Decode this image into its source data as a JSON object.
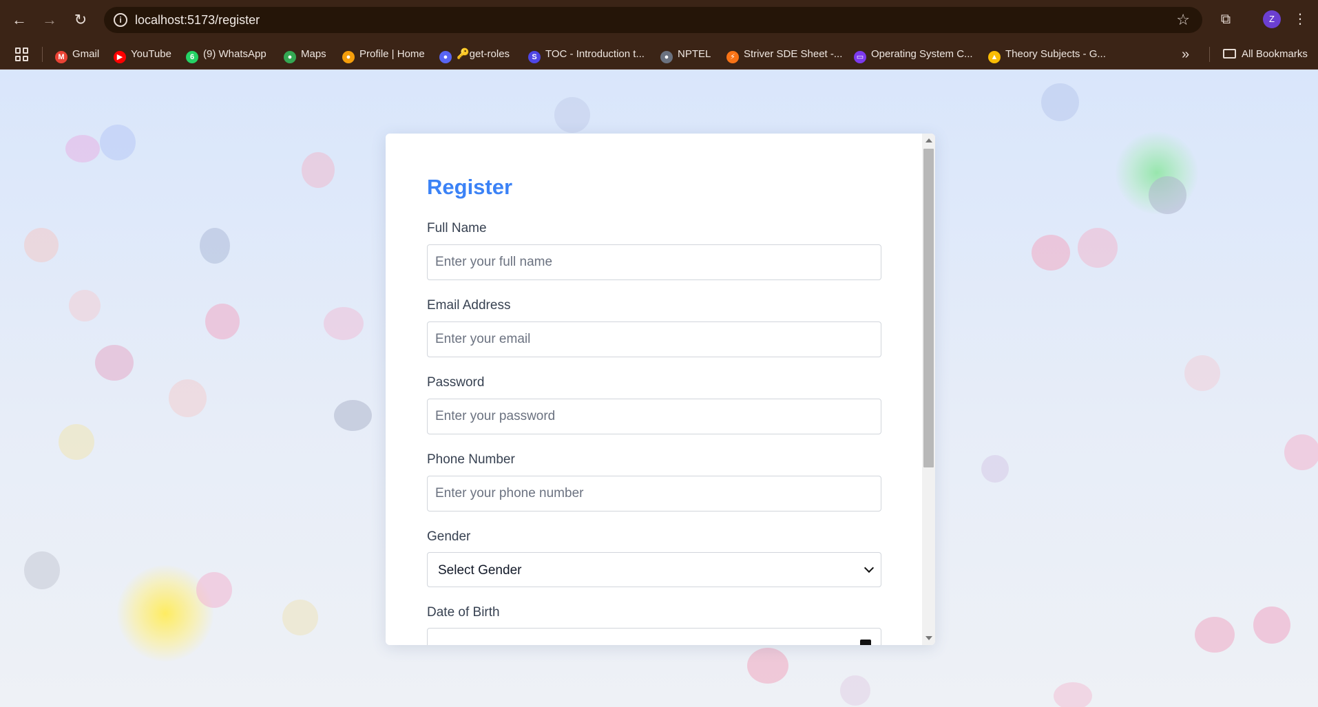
{
  "browser": {
    "url": "localhost:5173/register",
    "profile_initial": "Z",
    "bookmarks": [
      {
        "label": "Gmail",
        "icon": "gmail-icon",
        "color": "#ea4335",
        "glyph": "M"
      },
      {
        "label": "YouTube",
        "icon": "youtube-icon",
        "color": "#ff0000",
        "glyph": "▶"
      },
      {
        "label": "(9) WhatsApp",
        "icon": "whatsapp-icon",
        "color": "#25d366",
        "glyph": "6"
      },
      {
        "label": "Maps",
        "icon": "maps-icon",
        "color": "#34a853",
        "glyph": "●"
      },
      {
        "label": "Profile | Home",
        "icon": "profile-home-icon",
        "color": "#f59e0b",
        "glyph": "●"
      },
      {
        "label": "🔑get-roles",
        "icon": "discord-icon",
        "color": "#5865f2",
        "glyph": "●"
      },
      {
        "label": "TOC - Introduction t...",
        "icon": "toc-icon",
        "color": "#4f46e5",
        "glyph": "S"
      },
      {
        "label": "NPTEL",
        "icon": "nptel-icon",
        "color": "#6b7280",
        "glyph": "●"
      },
      {
        "label": "Striver SDE Sheet -...",
        "icon": "striver-icon",
        "color": "#f97316",
        "glyph": "⚡"
      },
      {
        "label": "Operating System C...",
        "icon": "operating-system-icon",
        "color": "#7c3aed",
        "glyph": "▭"
      },
      {
        "label": "Theory Subjects - G...",
        "icon": "google-drive-icon",
        "color": "#fbbc04",
        "glyph": "▲"
      }
    ],
    "all_bookmarks": "All Bookmarks"
  },
  "form": {
    "title": "Register",
    "full_name": {
      "label": "Full Name",
      "placeholder": "Enter your full name"
    },
    "email": {
      "label": "Email Address",
      "placeholder": "Enter your email"
    },
    "password": {
      "label": "Password",
      "placeholder": "Enter your password"
    },
    "phone": {
      "label": "Phone Number",
      "placeholder": "Enter your phone number"
    },
    "gender": {
      "label": "Gender",
      "selected": "Select Gender"
    },
    "dob": {
      "label": "Date of Birth"
    }
  },
  "colors": {
    "accent": "#3b82f6",
    "chrome": "#3b2416"
  }
}
